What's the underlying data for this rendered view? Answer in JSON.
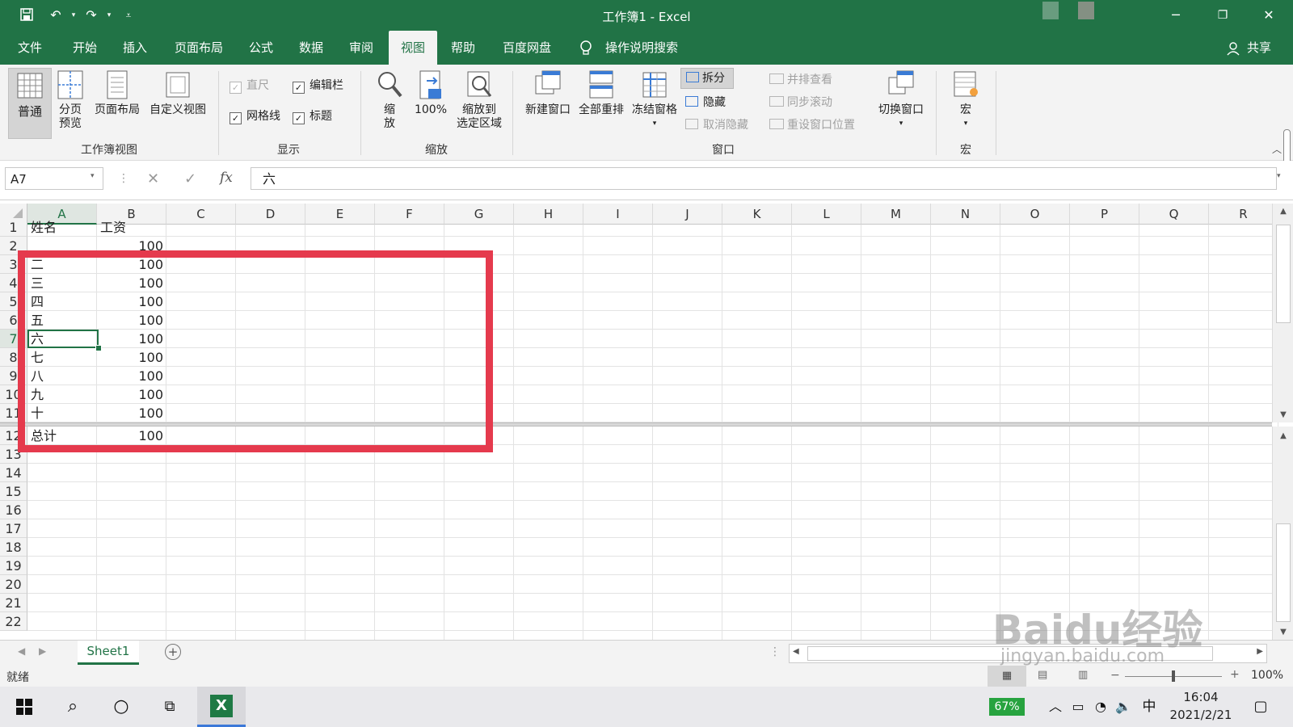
{
  "window": {
    "title": "工作簿1  -  Excel"
  },
  "tabs": [
    "文件",
    "开始",
    "插入",
    "页面布局",
    "公式",
    "数据",
    "审阅",
    "视图",
    "帮助",
    "百度网盘"
  ],
  "active_tab": "视图",
  "tell_me": "操作说明搜索",
  "share": "共享",
  "ribbon": {
    "workbook_views": {
      "label": "工作簿视图",
      "normal": "普通",
      "page_break_1": "分页",
      "page_break_2": "预览",
      "page_layout": "页面布局",
      "custom_views": "自定义视图"
    },
    "show": {
      "label": "显示",
      "ruler": "直尺",
      "formula_bar": "编辑栏",
      "gridlines": "网格线",
      "headings": "标题"
    },
    "zoom": {
      "label": "缩放",
      "zoom_1": "缩",
      "zoom_2": "放",
      "zoom_100": "100%",
      "zoom_sel_1": "缩放到",
      "zoom_sel_2": "选定区域"
    },
    "window": {
      "label": "窗口",
      "new_window": "新建窗口",
      "arrange_all": "全部重排",
      "freeze_panes": "冻结窗格",
      "split": "拆分",
      "hide": "隐藏",
      "unhide": "取消隐藏",
      "side_by_side": "并排查看",
      "sync_scroll": "同步滚动",
      "reset_position": "重设窗口位置",
      "switch_windows": "切换窗口"
    },
    "macros": {
      "label": "宏",
      "macro": "宏"
    }
  },
  "formula_bar": {
    "name_box": "A7",
    "content": "六"
  },
  "columns": [
    "A",
    "B",
    "C",
    "D",
    "E",
    "F",
    "G",
    "H",
    "I",
    "J",
    "K",
    "L",
    "M",
    "N",
    "O",
    "P",
    "Q",
    "R"
  ],
  "upper_rows": [
    {
      "row": "1",
      "a": "姓名",
      "b": "工资"
    },
    {
      "row": "2",
      "a": "",
      "b": "100"
    },
    {
      "row": "3",
      "a": "二",
      "b": "100"
    },
    {
      "row": "4",
      "a": "三",
      "b": "100"
    },
    {
      "row": "5",
      "a": "四",
      "b": "100"
    },
    {
      "row": "6",
      "a": "五",
      "b": "100"
    },
    {
      "row": "7",
      "a": "六",
      "b": "100"
    },
    {
      "row": "8",
      "a": "七",
      "b": "100"
    },
    {
      "row": "9",
      "a": "八",
      "b": "100"
    },
    {
      "row": "10",
      "a": "九",
      "b": "100"
    },
    {
      "row": "11",
      "a": "十",
      "b": "100"
    }
  ],
  "lower_rows": [
    {
      "row": "12",
      "a": "总计",
      "b": "100"
    },
    {
      "row": "13",
      "a": "",
      "b": ""
    },
    {
      "row": "14",
      "a": "",
      "b": ""
    },
    {
      "row": "15",
      "a": "",
      "b": ""
    },
    {
      "row": "16",
      "a": "",
      "b": ""
    },
    {
      "row": "17",
      "a": "",
      "b": ""
    },
    {
      "row": "18",
      "a": "",
      "b": ""
    },
    {
      "row": "19",
      "a": "",
      "b": ""
    },
    {
      "row": "20",
      "a": "",
      "b": ""
    },
    {
      "row": "21",
      "a": "",
      "b": ""
    },
    {
      "row": "22",
      "a": "",
      "b": ""
    }
  ],
  "sheet_tab": "Sheet1",
  "status": {
    "ready": "就绪",
    "zoom": "100%"
  },
  "taskbar": {
    "battery": "67%",
    "ime": "中",
    "time": "16:04",
    "date": "2021/2/21"
  },
  "watermark": {
    "logo": "Baidu经验",
    "url": "jingyan.baidu.com"
  },
  "colors": {
    "excel_green": "#217346",
    "highlight_red": "#e53a4d"
  }
}
